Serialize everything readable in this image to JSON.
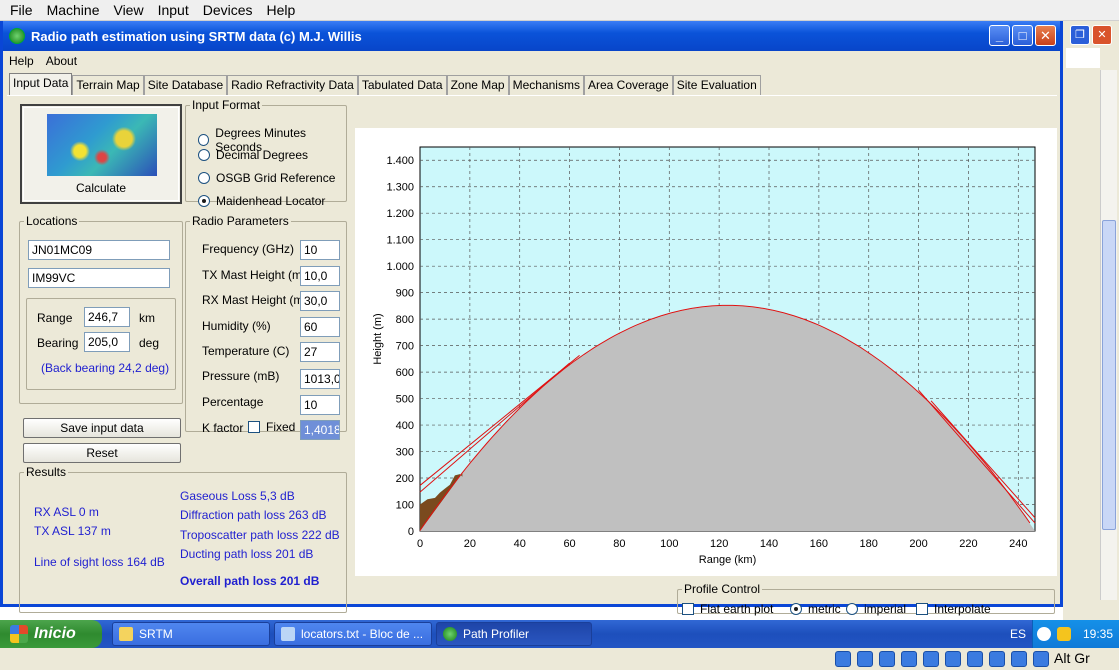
{
  "host_menu": [
    "File",
    "Machine",
    "View",
    "Input",
    "Devices",
    "Help"
  ],
  "window": {
    "title": "Radio path estimation using SRTM data (c) M.J. Willis",
    "menu": [
      "Help",
      "About"
    ],
    "controls": {
      "minimize": "_",
      "maximize": "□",
      "close": "✕"
    }
  },
  "tabs": [
    "Input Data",
    "Terrain Map",
    "Site Database",
    "Radio Refractivity Data",
    "Tabulated Data",
    "Zone Map",
    "Mechanisms",
    "Area Coverage",
    "Site Evaluation"
  ],
  "calculate": {
    "label": "Calculate"
  },
  "input_format": {
    "title": "Input Format",
    "options": [
      "Degrees Minutes Seconds",
      "Decimal Degrees",
      "OSGB Grid Reference",
      "Maidenhead Locator"
    ],
    "selected_index": 3
  },
  "locations": {
    "title": "Locations",
    "loc1": "JN01MC09",
    "loc2": "IM99VC",
    "range_label": "Range",
    "range_value": "246,7",
    "range_unit": "km",
    "bearing_label": "Bearing",
    "bearing_value": "205,0",
    "bearing_unit": "deg",
    "back_bearing": "(Back bearing 24,2 deg)"
  },
  "radio_params": {
    "title": "Radio Parameters",
    "rows": [
      {
        "label": "Frequency (GHz)",
        "value": "10"
      },
      {
        "label": "TX Mast Height (m)",
        "value": "10,0"
      },
      {
        "label": "RX Mast Height (m)",
        "value": "30,0"
      },
      {
        "label": "Humidity (%)",
        "value": "60"
      },
      {
        "label": "Temperature (C)",
        "value": "27"
      },
      {
        "label": "Pressure (mB)",
        "value": "1013,0"
      },
      {
        "label": "Percentage",
        "value": "10"
      }
    ],
    "kfactor_label": "K factor",
    "fixed_label": "Fixed",
    "kfactor_value": "1,4018"
  },
  "buttons": {
    "save": "Save input data",
    "reset": "Reset"
  },
  "results": {
    "title": "Results",
    "rx_asl": "RX ASL 0 m",
    "tx_asl": "TX ASL 137 m",
    "los_loss": "Line of sight loss 164 dB",
    "gaseous": "Gaseous Loss 5,3 dB",
    "diffraction": "Diffraction path loss 263 dB",
    "troposcatter": "Troposcatter path loss 222 dB",
    "ducting": "Ducting path loss 201 dB",
    "overall": "Overall path loss 201 dB"
  },
  "profile_control": {
    "title": "Profile Control",
    "flat_earth": "Flat earth plot",
    "metric": "metric",
    "imperial": "imperial",
    "interpolate": "Interpolate",
    "unit_selected": "metric"
  },
  "chart_data": {
    "type": "area",
    "xlabel": "Range (km)",
    "ylabel": "Height (m)",
    "xlim": [
      0,
      246.7
    ],
    "ylim": [
      0,
      1450
    ],
    "x_ticks": [
      0,
      20,
      40,
      60,
      80,
      100,
      120,
      140,
      160,
      180,
      200,
      220,
      240
    ],
    "y_ticks": [
      "0",
      "100",
      "200",
      "300",
      "400",
      "500",
      "600",
      "700",
      "800",
      "900",
      "1.000",
      "1.100",
      "1.200",
      "1.300",
      "1.400"
    ],
    "y_tick_values": [
      0,
      100,
      200,
      300,
      400,
      500,
      600,
      700,
      800,
      900,
      1000,
      1100,
      1200,
      1300,
      1400
    ],
    "earth_bulge_peak": {
      "x": 123.35,
      "y": 850
    },
    "terrain": [
      [
        0,
        100
      ],
      [
        3,
        120
      ],
      [
        6,
        125
      ],
      [
        8,
        145
      ],
      [
        10,
        160
      ],
      [
        12,
        175
      ],
      [
        14,
        210
      ],
      [
        16,
        215
      ],
      [
        17,
        205
      ]
    ],
    "tx_height": 147,
    "rx_height": 30,
    "grid": true,
    "background_color": "#ccf8fb",
    "earth_color": "#c0c0c0",
    "terrain_color": "#7a4a1e",
    "path_color": "#e01010"
  },
  "taskbar": {
    "start": "Inicio",
    "tasks": [
      "SRTM",
      "locators.txt - Bloc de ...",
      "Path Profiler"
    ],
    "lang": "ES",
    "time": "19:35"
  },
  "bottom_bar": {
    "keyboard": "Alt Gr"
  }
}
